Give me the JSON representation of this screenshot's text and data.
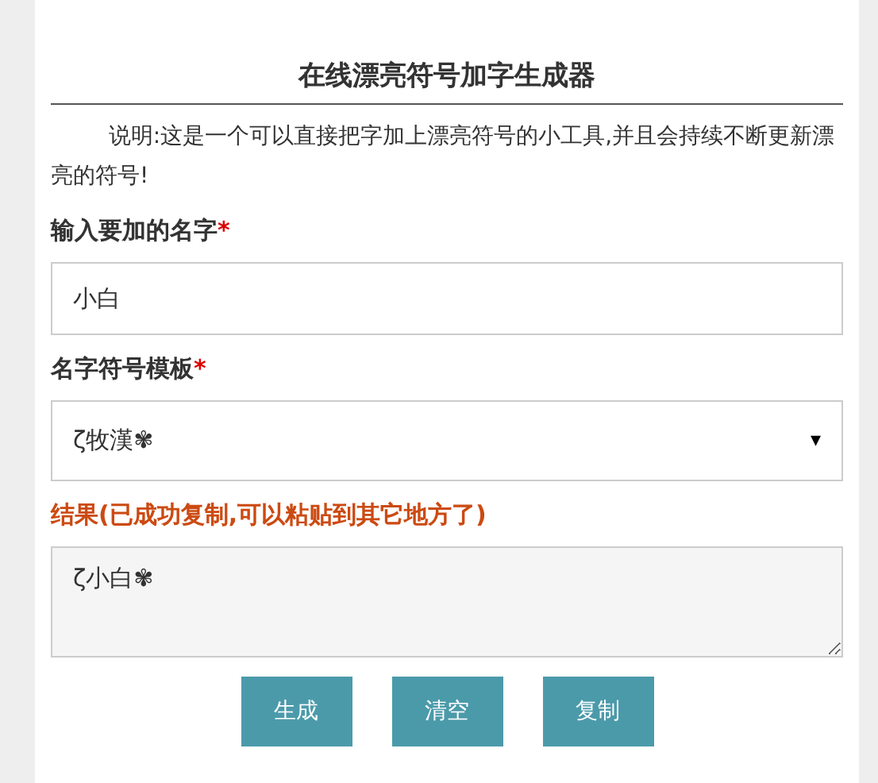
{
  "title": "在线漂亮符号加字生成器",
  "description": "说明:这是一个可以直接把字加上漂亮符号的小工具,并且会持续不断更新漂亮的符号!",
  "name_field": {
    "label": "输入要加的名字",
    "required_mark": "*",
    "value": "小白"
  },
  "template_select": {
    "label": "名字符号模板",
    "required_mark": "*",
    "value": "ζ牧漢✾",
    "arrow": "▾"
  },
  "result": {
    "label": "结果(已成功复制,可以粘贴到其它地方了)",
    "value": "ζ小白✾"
  },
  "buttons": [
    "生成",
    "清空",
    "复制"
  ]
}
